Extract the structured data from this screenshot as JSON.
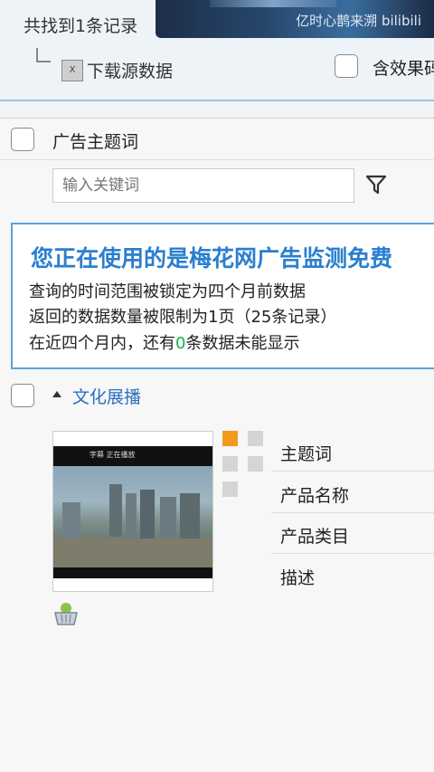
{
  "header": {
    "found_text": "共找到1条记录",
    "watermark": "亿时心鹊来溯 bilibili",
    "download_label": "下载源数据",
    "effect_label": "含效果码"
  },
  "table": {
    "column_title": "广告主题词",
    "search_placeholder": "输入关键词"
  },
  "notice": {
    "title": "您正在使用的是梅花网广告监测免费",
    "line1": "查询的时间范围被锁定为四个月前数据",
    "line2": "返回的数据数量被限制为1页（25条记录）",
    "line3_prefix": "在近四个月内，还有",
    "line3_count": "0",
    "line3_suffix": "条数据未能显示"
  },
  "category": {
    "label": "文化展播"
  },
  "record": {
    "fields": [
      "主题词",
      "产品名称",
      "产品类目",
      "描述"
    ],
    "thumbnail_caption": "字幕 正在播放",
    "swatch_colors": [
      "#f39a1e",
      "#d5d5d5"
    ]
  }
}
